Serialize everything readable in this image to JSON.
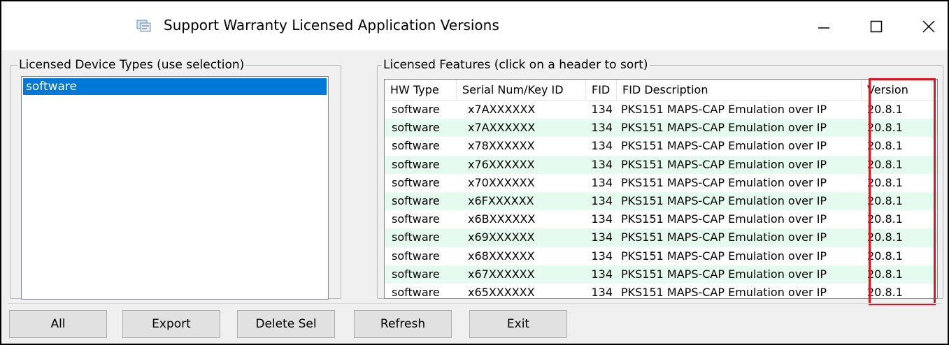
{
  "window": {
    "title": "Support Warranty Licensed Application Versions",
    "icon": "application-icon"
  },
  "left_panel": {
    "label": "Licensed Device Types (use selection)",
    "items": [
      {
        "label": "software",
        "selected": true
      }
    ]
  },
  "right_panel": {
    "label": "Licensed Features   (click on a header to sort)",
    "columns": [
      "HW Type",
      "Serial Num/Key ID",
      "FID",
      "FID Description",
      "Version"
    ],
    "rows": [
      {
        "hw": "software",
        "serial": "x7AXXXXXX",
        "fid": "134",
        "desc": "PKS151 MAPS-CAP Emulation over IP",
        "version": "20.8.1"
      },
      {
        "hw": "software",
        "serial": "x7AXXXXXX",
        "fid": "134",
        "desc": "PKS151 MAPS-CAP Emulation over IP",
        "version": "20.8.1"
      },
      {
        "hw": "software",
        "serial": "x78XXXXXX",
        "fid": "134",
        "desc": "PKS151 MAPS-CAP Emulation over IP",
        "version": "20.8.1"
      },
      {
        "hw": "software",
        "serial": "x76XXXXXX",
        "fid": "134",
        "desc": "PKS151 MAPS-CAP Emulation over IP",
        "version": "20.8.1"
      },
      {
        "hw": "software",
        "serial": "x70XXXXXX",
        "fid": "134",
        "desc": "PKS151 MAPS-CAP Emulation over IP",
        "version": "20.8.1"
      },
      {
        "hw": "software",
        "serial": "x6FXXXXXX",
        "fid": "134",
        "desc": "PKS151 MAPS-CAP Emulation over IP",
        "version": "20.8.1"
      },
      {
        "hw": "software",
        "serial": "x6BXXXXXX",
        "fid": "134",
        "desc": "PKS151 MAPS-CAP Emulation over IP",
        "version": "20.8.1"
      },
      {
        "hw": "software",
        "serial": "x69XXXXXX",
        "fid": "134",
        "desc": "PKS151 MAPS-CAP Emulation over IP",
        "version": "20.8.1"
      },
      {
        "hw": "software",
        "serial": "x68XXXXXX",
        "fid": "134",
        "desc": "PKS151 MAPS-CAP Emulation over IP",
        "version": "20.8.1"
      },
      {
        "hw": "software",
        "serial": "x67XXXXXX",
        "fid": "134",
        "desc": "PKS151 MAPS-CAP Emulation over IP",
        "version": "20.8.1"
      },
      {
        "hw": "software",
        "serial": "x65XXXXXX",
        "fid": "134",
        "desc": "PKS151 MAPS-CAP Emulation over IP",
        "version": "20.8.1"
      }
    ],
    "row_stripe_color": "#e6fbf0",
    "highlight_color": "#e0141e"
  },
  "buttons": {
    "all": "All",
    "export": "Export",
    "delete_sel": "Delete Sel",
    "refresh": "Refresh",
    "exit": "Exit"
  },
  "colors": {
    "selection": "#0078d7",
    "dialog_bg": "#f0f0f0"
  }
}
